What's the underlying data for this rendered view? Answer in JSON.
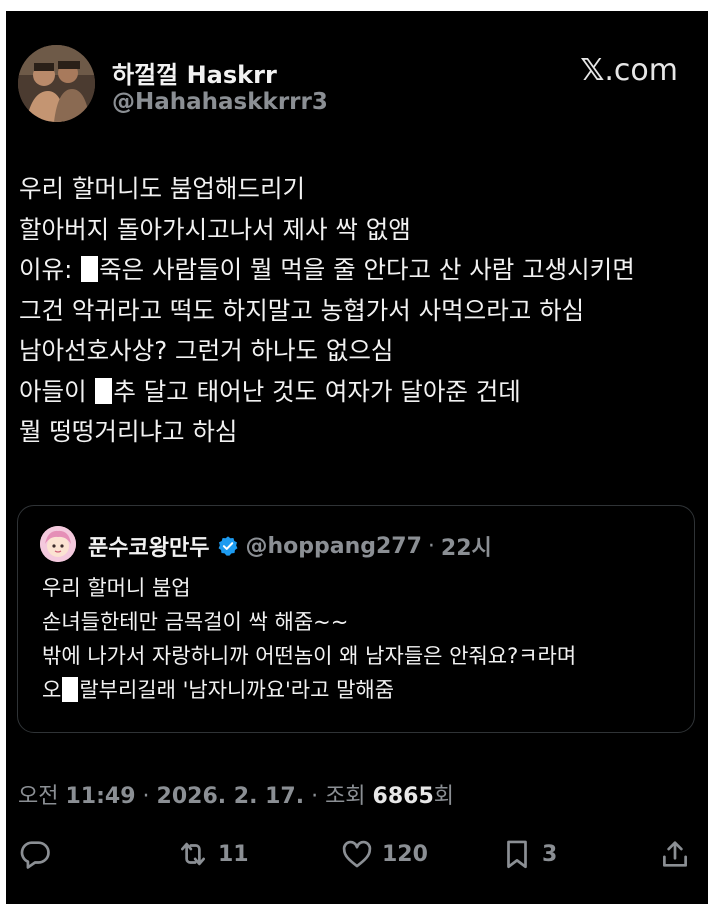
{
  "tweet": {
    "author": {
      "name": "하껄껄 Haskrr",
      "handle": "@Hahahaskkrrr3"
    },
    "brand": {
      "x_mark": "𝕏",
      "suffix": ".com"
    },
    "lines": [
      {
        "text": "우리 할머니도 붐업해드리기"
      },
      {
        "text": "할아버지 돌아가시고나서 제사 싹 없앰"
      },
      {
        "before": "이유: ",
        "after": "죽은 사람들이 뭘 먹을 줄 안다고 산 사람 고생시키면"
      },
      {
        "text": "그건 악귀라고 떡도 하지말고 농협가서 사먹으라고 하심"
      },
      {
        "text": "남아선호사상? 그런거 하나도 없으심"
      },
      {
        "before": "아들이 ",
        "after": "추 달고 태어난 것도 여자가 달아준 건데"
      },
      {
        "text": "뭘 떵떵거리냐고 하심"
      }
    ],
    "quote": {
      "name": "푼수코왕만두",
      "handle": "@hoppang277",
      "separator": "·",
      "time": "22시",
      "lines": [
        {
          "text": "우리 할머니 붐업"
        },
        {
          "text": "손녀들한테만 금목걸이 싹 해줌~~"
        },
        {
          "text": "밖에 나가서 자랑하니까 어떤놈이 왜 남자들은 안줘요?ㅋ라며"
        },
        {
          "before": "오",
          "after": "랄부리길래 '남자니까요'라고 말해줌"
        }
      ]
    },
    "meta": {
      "ampm": "오전",
      "time": "11:49",
      "sep1": "·",
      "date": "2026. 2. 17.",
      "sep2": "·",
      "views_label": "조회",
      "views_count": "6865",
      "views_suffix": "회"
    },
    "actions": {
      "reply_icon": "speech-bubble-icon",
      "retweet_icon": "retweet-arrows-icon",
      "retweet_count": "11",
      "like_icon": "heart-icon",
      "like_count": "120",
      "bookmark_icon": "bookmark-icon",
      "bookmark_count": "3",
      "share_icon": "share-upload-icon"
    }
  },
  "colors": {
    "background": "#000000",
    "text": "#f2f2f2",
    "secondary": "#8b8f94",
    "border": "#2f3336",
    "verified": "#1d9bf0"
  }
}
